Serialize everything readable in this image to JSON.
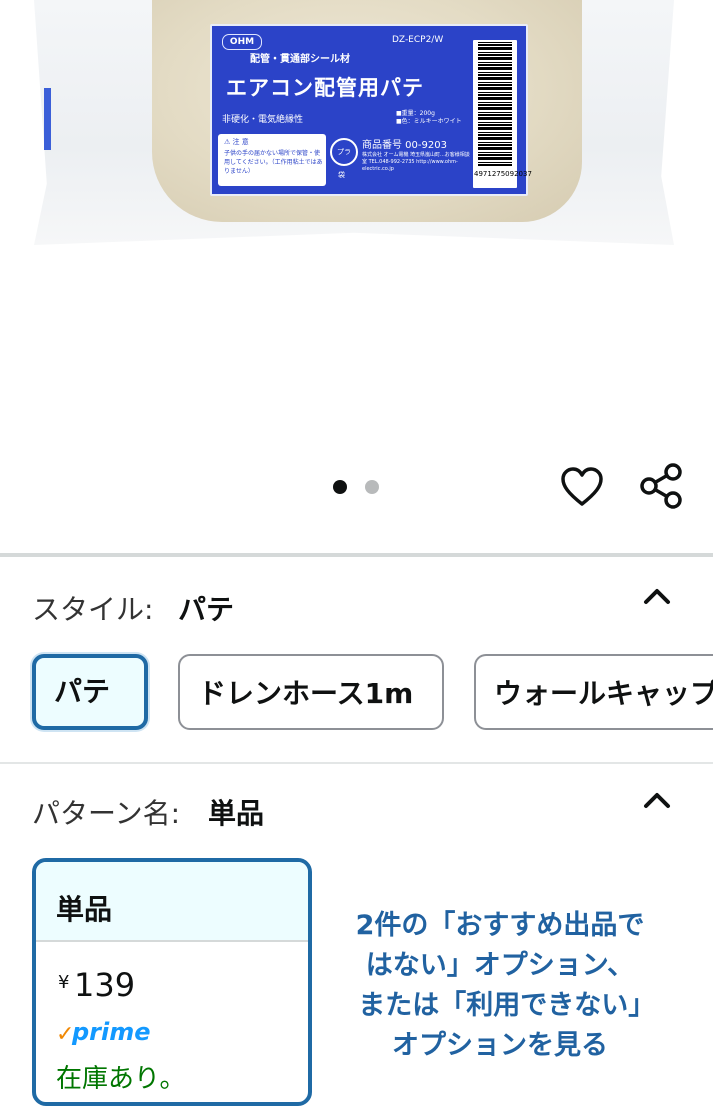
{
  "product_image": {
    "label": {
      "brand_logo": "OHM",
      "model_code": "DZ-ECP2/W",
      "subtitle": "配管・貫通部シール材",
      "title": "エアコン配管用パテ",
      "feature": "非硬化・電気絶縁性",
      "weight": "■重量：200g",
      "color": "■色：ミルキーホワイト",
      "notice_title": "⚠ 注 意",
      "notice_text": "子供の手の届かない場所で保管・使用してください。（工作用粘土ではありません）",
      "recycle_mark": "プラ",
      "recycle_sub": "袋",
      "product_number": "商品番号 00-9203",
      "company": "株式会社 オーム電機 埼玉県嵐山町...お客様相談室 TEL.048-992-2735 http://www.ohm-electric.co.jp",
      "barcode_number": "4971275092037"
    },
    "carousel": {
      "total": 2,
      "active": 1
    }
  },
  "actions": {
    "wishlist_icon": "heart-icon",
    "share_icon": "share-icon"
  },
  "style_selector": {
    "label": "スタイル:",
    "value": "パテ",
    "options": [
      "パテ",
      "ドレンホース1m",
      "ウォールキャップ"
    ],
    "selected": "パテ"
  },
  "pattern_selector": {
    "label": "パターン名:",
    "value": "単品",
    "card": {
      "title": "単品",
      "currency": "¥",
      "price": "139",
      "prime_check": "✓",
      "prime": "prime",
      "stock": "在庫あり。"
    },
    "other_options_link": "2件の「おすすめ出品ではない」オプション、または「利用できない」オプションを見る"
  },
  "colors": {
    "accent": "#1f6aa5",
    "link": "#2162a1",
    "stock": "#007600",
    "prime": "#1399ff"
  }
}
